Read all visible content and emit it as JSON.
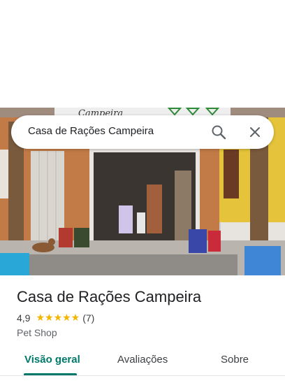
{
  "search": {
    "query": "Casa de Rações Campeira"
  },
  "photo": {
    "sign_text": "Campeira"
  },
  "place": {
    "name": "Casa de Rações Campeira",
    "rating": "4,9",
    "review_count": "(7)",
    "stars": "★★★★★",
    "rating_value": 4.9,
    "category": "Pet Shop"
  },
  "tabs": [
    {
      "label": "Visão geral",
      "active": true
    },
    {
      "label": "Avaliações",
      "active": false
    },
    {
      "label": "Sobre",
      "active": false
    }
  ],
  "icons": {
    "search": "search-icon",
    "close": "close-icon"
  },
  "colors": {
    "accent": "#00796b",
    "star": "#f4b400"
  }
}
